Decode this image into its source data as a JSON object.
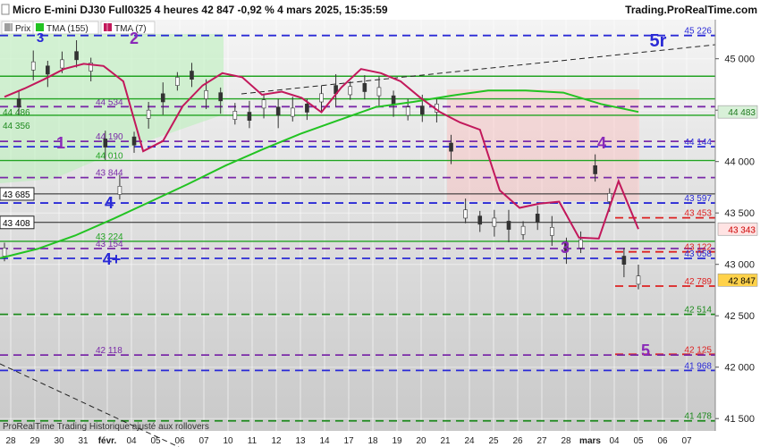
{
  "header": {
    "title": "Micro E-mini DJ30 Full0325 4 heures 42 847 -0,92 % 4 mars 2025, 15:35:59",
    "site": "Trading.ProRealTime.com"
  },
  "legend": [
    {
      "label": "Prix",
      "color": "#9e9e9e"
    },
    {
      "label": "TMA (155)",
      "color": "#22c322"
    },
    {
      "label": "TMA (7)",
      "color": "#c2185b"
    }
  ],
  "footer": "ProRealTime Trading  Historique ajusté aux rollovers",
  "chart_data": {
    "type": "line",
    "title": "Micro E-mini DJ30 Full0325 4 heures",
    "ylim": [
      41380,
      45380
    ],
    "x_labels": [
      "28",
      "29",
      "30",
      "31",
      "févr.",
      "04",
      "05",
      "06",
      "07",
      "10",
      "11",
      "12",
      "13",
      "14",
      "17",
      "18",
      "19",
      "20",
      "21",
      "24",
      "25",
      "26",
      "27",
      "28",
      "mars",
      "04",
      "05",
      "06",
      "07"
    ],
    "price_axis": {
      "ticks": [
        "45 000",
        "44 500",
        "44 000",
        "43 500",
        "43 000",
        "42 500",
        "42 000",
        "41 500"
      ],
      "tick_values": [
        45000,
        44500,
        44000,
        43500,
        43000,
        42500,
        42000,
        41500
      ],
      "tags": [
        {
          "text": "44 483",
          "value": 44483,
          "bg": "#d8f0d8",
          "fg": "#1e7a1e"
        },
        {
          "text": "43 343",
          "value": 43343,
          "bg": "#ffe3e3",
          "fg": "#cc0000"
        },
        {
          "text": "42 847",
          "value": 42847,
          "bg": "#ffd24a",
          "fg": "#000000"
        }
      ]
    },
    "series": [
      {
        "name": "Prix",
        "color": "#444444",
        "values": [
          43120,
          44570,
          44930,
          44890,
          44950,
          45030,
          44920,
          44180,
          43720,
          44200,
          44460,
          44620,
          44780,
          44840,
          44650,
          44630,
          44450,
          44440,
          44560,
          44490,
          44480,
          44520,
          44620,
          44700,
          44690,
          44720,
          44680,
          44600,
          44490,
          44500,
          44520,
          44140,
          43490,
          43430,
          43410,
          43380,
          43330,
          43450,
          43320,
          43170,
          43200,
          43920,
          43650,
          43040,
          42847
        ]
      },
      {
        "name": "TMA (155)",
        "color": "#22c322",
        "values": [
          43060,
          43150,
          43280,
          43440,
          43610,
          43780,
          43960,
          44120,
          44270,
          44400,
          44530,
          44580,
          44640,
          44690,
          44690,
          44670,
          44560,
          44483
        ]
      },
      {
        "name": "TMA (7)",
        "color": "#c2185b",
        "values": [
          44630,
          44710,
          44800,
          44900,
          44950,
          44930,
          44780,
          44100,
          44200,
          44540,
          44740,
          44860,
          44820,
          44650,
          44680,
          44620,
          44480,
          44720,
          44900,
          44860,
          44780,
          44620,
          44480,
          44380,
          44310,
          43720,
          43550,
          43590,
          43610,
          43260,
          43250,
          43810,
          43343
        ]
      }
    ],
    "horizontal_levels": [
      {
        "value": 45226,
        "text": "45 226",
        "style": "dash",
        "color": "#2a2ad6",
        "label_side": "right"
      },
      {
        "value": 44534,
        "text": "44 534",
        "style": "dash",
        "color": "#7a2aa8",
        "label_side": "left"
      },
      {
        "value": 44196,
        "text": "44 190",
        "style": "dash",
        "color": "#7a2aa8",
        "label_side": "left"
      },
      {
        "value": 44144,
        "text": "44 144",
        "style": "dash",
        "color": "#2a2ad6",
        "label_side": "right"
      },
      {
        "value": 44010,
        "text": "44 010",
        "style": "solid",
        "color": "#22a322",
        "label_side": "left"
      },
      {
        "value": 43844,
        "text": "43 844",
        "style": "dash",
        "color": "#7a2aa8",
        "label_side": "left"
      },
      {
        "value": 43597,
        "text": "43 597",
        "style": "dash",
        "color": "#2a2ad6",
        "label_side": "right"
      },
      {
        "value": 43453,
        "text": "43 453",
        "style": "dash",
        "color": "#dd2222",
        "label_side": "right"
      },
      {
        "value": 43224,
        "text": "43 224",
        "style": "solid",
        "color": "#22a322",
        "label_side": "left"
      },
      {
        "value": 43154,
        "text": "43 154",
        "style": "dash",
        "color": "#7a2aa8",
        "label_side": "left"
      },
      {
        "value": 43122,
        "text": "43 122",
        "style": "dash",
        "color": "#dd2222",
        "label_side": "right"
      },
      {
        "value": 43058,
        "text": "43 058",
        "style": "dash",
        "color": "#2a2ad6",
        "label_side": "right"
      },
      {
        "value": 42789,
        "text": "42 789",
        "style": "dash",
        "color": "#dd2222",
        "label_side": "right"
      },
      {
        "value": 42514,
        "text": "42 514",
        "style": "dash",
        "color": "#1e8a1e",
        "label_side": "right"
      },
      {
        "value": 42125,
        "text": "42 125",
        "style": "dash",
        "color": "#dd2222",
        "label_side": "right"
      },
      {
        "value": 42118,
        "text": "42 118",
        "style": "dash",
        "color": "#7a2aa8",
        "label_side": "left"
      },
      {
        "value": 41968,
        "text": "41 968",
        "style": "dash",
        "color": "#2a2ad6",
        "label_side": "right"
      },
      {
        "value": 41478,
        "text": "41 478",
        "style": "dash",
        "color": "#1e8a1e",
        "label_side": "right"
      }
    ],
    "left_level_tags": [
      {
        "value": 44486,
        "text": "44 486",
        "color": "#1e8a1e"
      },
      {
        "value": 44356,
        "text": "44 356",
        "color": "#1e8a1e"
      },
      {
        "value": 43685,
        "text": "43 685",
        "color": "#000000",
        "boxed": true
      },
      {
        "value": 43408,
        "text": "43 408",
        "color": "#000000",
        "boxed": true
      }
    ],
    "annotations": [
      {
        "text": "3",
        "color": "#2a2ad6"
      },
      {
        "text": "2",
        "color": "#8a2ab8"
      },
      {
        "text": "5r",
        "color": "#2a2ad6"
      },
      {
        "text": "1",
        "color": "#8a2ab8"
      },
      {
        "text": "4",
        "color": "#8a2ab8"
      },
      {
        "text": "4",
        "color": "#2a2ad6"
      },
      {
        "text": "4+",
        "color": "#2a2ad6"
      },
      {
        "text": "3",
        "color": "#8a2ab8"
      },
      {
        "text": "5",
        "color": "#8a2ab8"
      }
    ],
    "grid": true
  }
}
